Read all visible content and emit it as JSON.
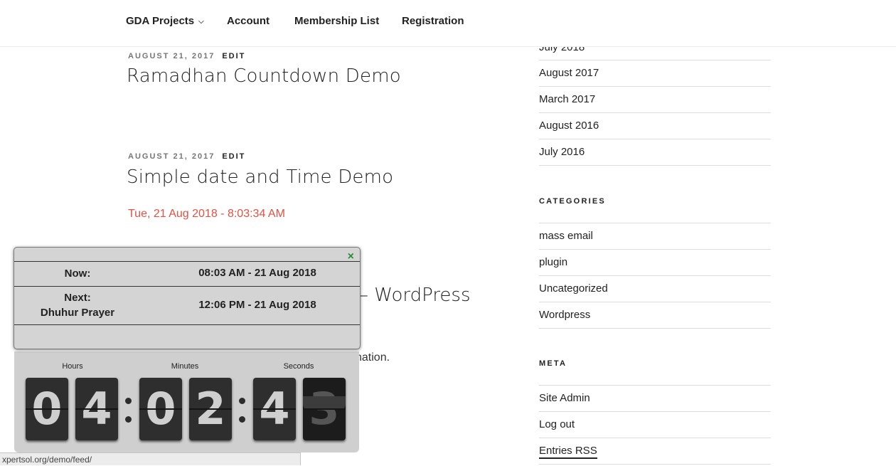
{
  "nav": {
    "items": [
      "GDA Projects",
      "Account",
      "Membership List",
      "Registration"
    ]
  },
  "posts": [
    {
      "date": "AUGUST 21, 2017",
      "edit": "EDIT",
      "title": "Ramadhan Countdown Demo"
    },
    {
      "date": "AUGUST 21, 2017",
      "edit": "EDIT",
      "title": "Simple date and Time Demo"
    }
  ],
  "current_datetime": "Tue, 21 Aug 2018 - 8:03:34 AM",
  "partial_post": {
    "title_fragment": "– WordPress",
    "text_fragment": "nation."
  },
  "sidebar": {
    "archives": [
      "July 2018",
      "August 2017",
      "March 2017",
      "August 2016",
      "July 2016"
    ],
    "categories_heading": "CATEGORIES",
    "categories": [
      "mass email",
      "plugin",
      "Uncategorized",
      "Wordpress"
    ],
    "meta_heading": "META",
    "meta": [
      "Site Admin",
      "Log out",
      "Entries RSS"
    ]
  },
  "prayer_widget": {
    "close_icon": "×",
    "now_label": "Now:",
    "now_value": "08:03 AM - 21 Aug 2018",
    "next_label": "Next:",
    "next_prayer": "Dhuhur Prayer",
    "next_value": "12:06 PM - 21 Aug 2018"
  },
  "countdown": {
    "hours_label": "Hours",
    "minutes_label": "Minutes",
    "seconds_label": "Seconds",
    "digits": [
      "0",
      "4",
      "0",
      "2",
      "4",
      "3"
    ]
  },
  "status_bar": {
    "url": "xpertsol.org/demo/feed/"
  }
}
